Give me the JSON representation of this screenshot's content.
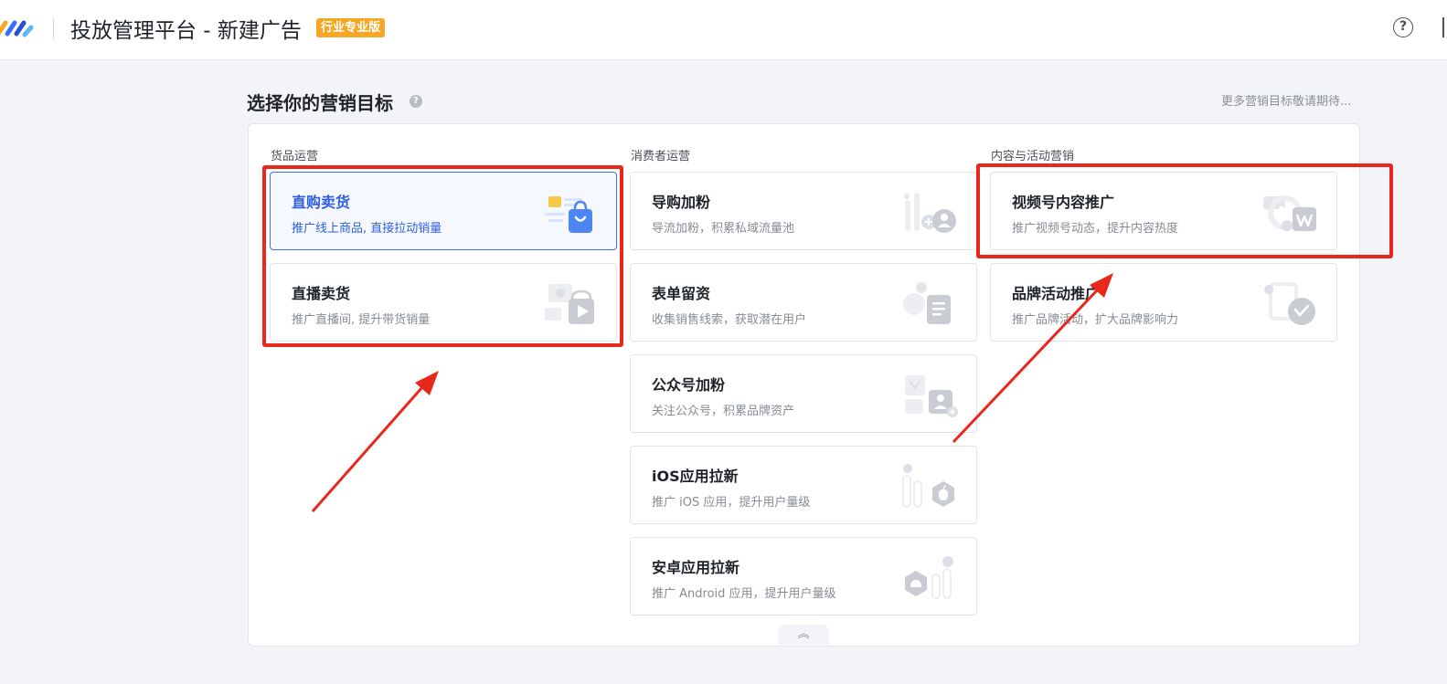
{
  "header": {
    "app_title": "投放管理平台 - 新建广告",
    "edition_badge": "行业专业版",
    "help_label": "?"
  },
  "section": {
    "title": "选择你的营销目标",
    "help_label": "?",
    "more_link": "更多营销目标敬请期待..."
  },
  "columns": [
    {
      "label": "货品运营",
      "cards": [
        {
          "title": "直购卖货",
          "desc": "推广线上商品, 直接拉动销量",
          "icon": "shopping-bag-icon",
          "selected": true
        },
        {
          "title": "直播卖货",
          "desc": "推广直播间, 提升带货销量",
          "icon": "live-play-icon",
          "selected": false
        }
      ]
    },
    {
      "label": "消费者运营",
      "cards": [
        {
          "title": "导购加粉",
          "desc": "导流加粉，积累私域流量池",
          "icon": "add-contact-icon",
          "selected": false
        },
        {
          "title": "表单留资",
          "desc": "收集销售线索，获取潜在用户",
          "icon": "form-doc-icon",
          "selected": false
        },
        {
          "title": "公众号加粉",
          "desc": "关注公众号，积累品牌资产",
          "icon": "official-account-icon",
          "selected": false
        },
        {
          "title": "iOS应用拉新",
          "desc": "推广 iOS 应用，提升用户量级",
          "icon": "apple-icon",
          "selected": false
        },
        {
          "title": "安卓应用拉新",
          "desc": "推广 Android 应用，提升用户量级",
          "icon": "android-icon",
          "selected": false
        }
      ]
    },
    {
      "label": "内容与活动营销",
      "cards": [
        {
          "title": "视频号内容推广",
          "desc": "推广视频号动态，提升内容热度",
          "icon": "channels-icon",
          "selected": false
        },
        {
          "title": "品牌活动推广",
          "desc": "推广品牌活动，扩大品牌影响力",
          "icon": "brand-event-icon",
          "selected": false
        }
      ]
    }
  ],
  "collapse_label": "︽",
  "colors": {
    "accent": "#3a6ff7",
    "badge": "#f5a623",
    "annotation": "#e8271d"
  }
}
